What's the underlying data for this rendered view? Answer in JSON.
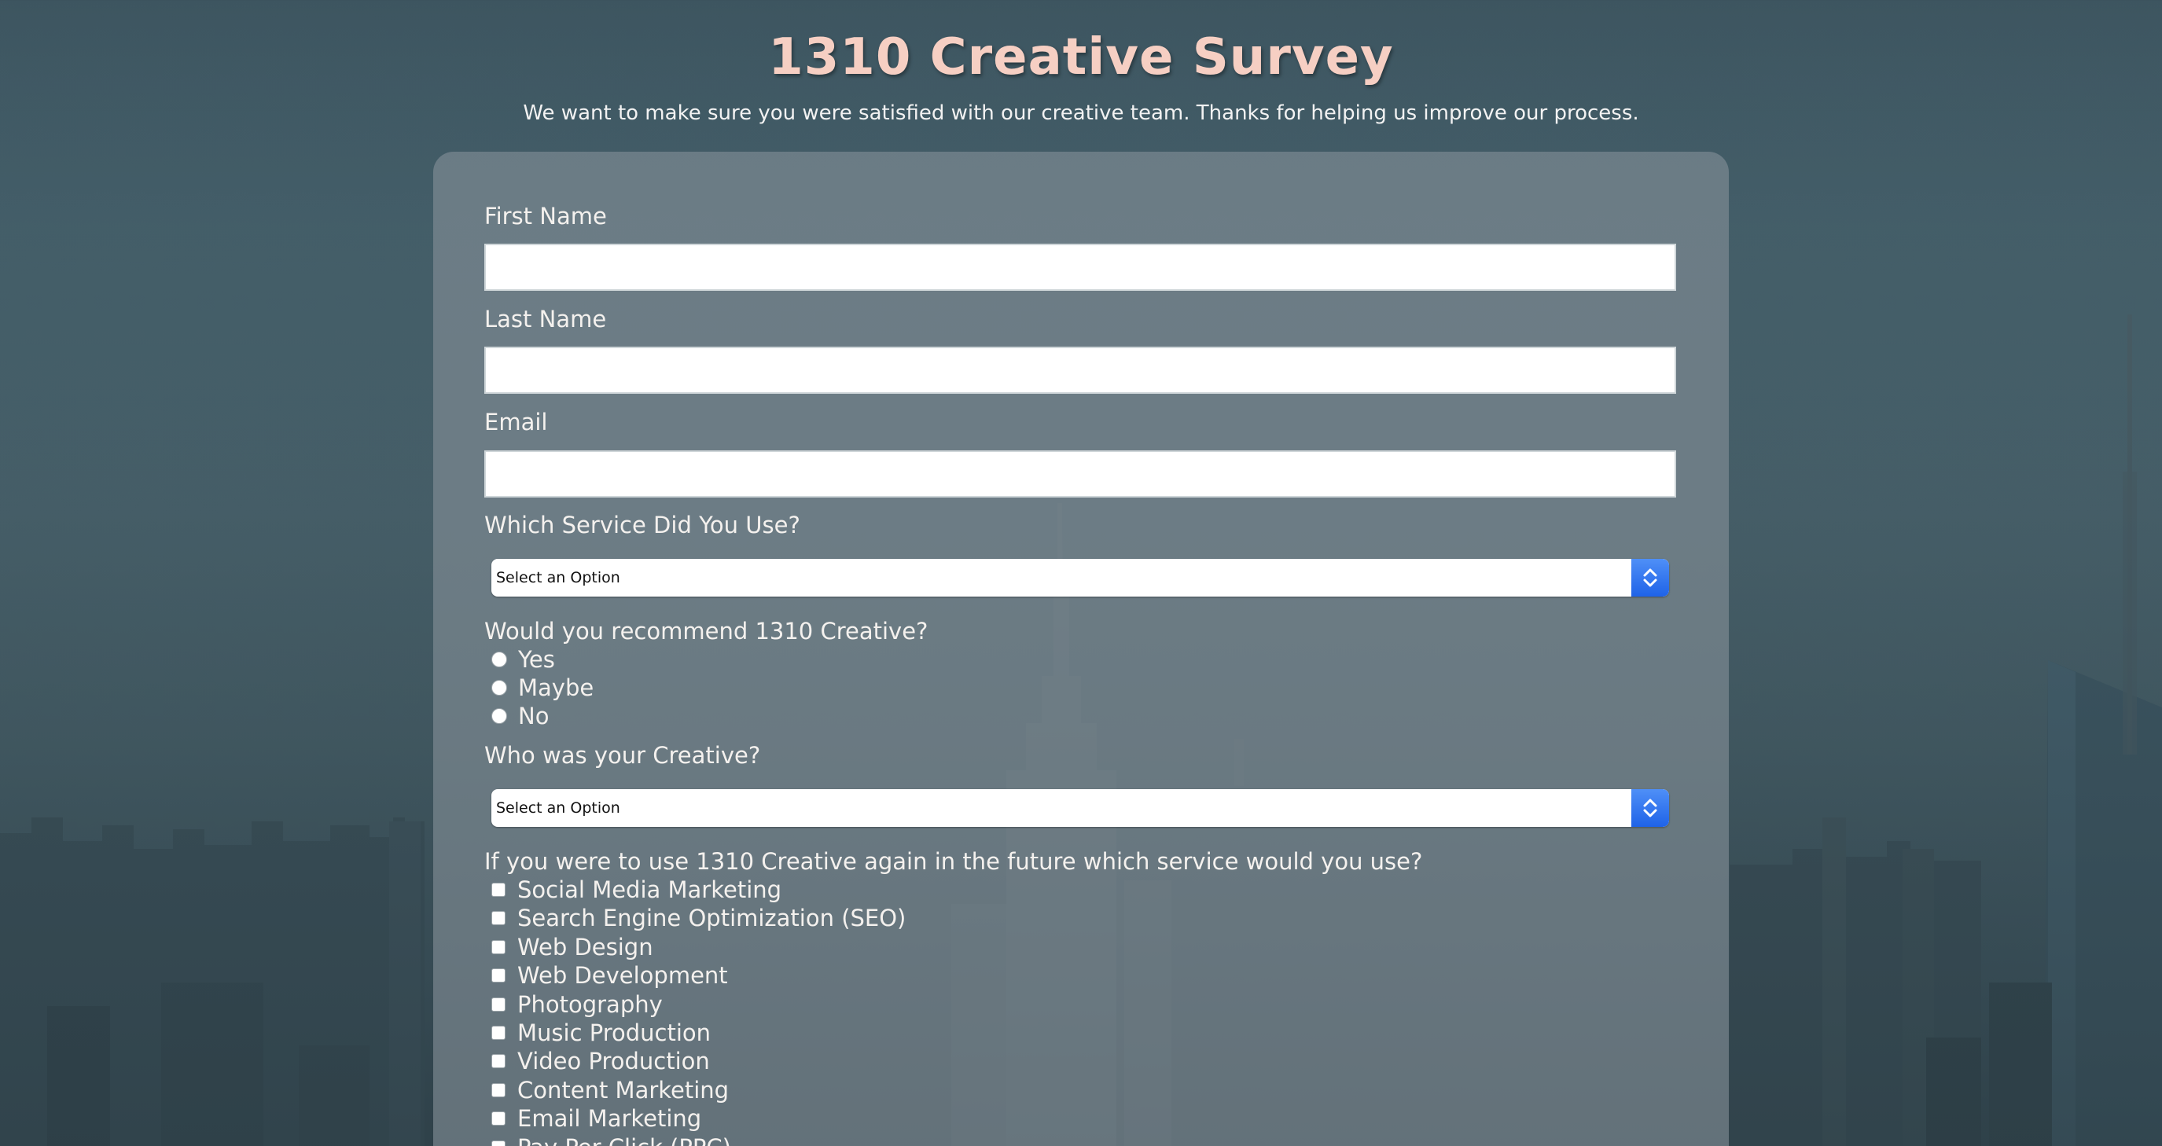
{
  "header": {
    "title": "1310 Creative Survey",
    "subtitle": "We want to make sure you were satisfied with our creative team. Thanks for helping us improve our process."
  },
  "form": {
    "first_name": {
      "label": "First Name",
      "value": "",
      "placeholder": ""
    },
    "last_name": {
      "label": "Last Name",
      "value": "",
      "placeholder": ""
    },
    "email": {
      "label": "Email",
      "value": "",
      "placeholder": ""
    },
    "service_used": {
      "label": "Which Service Did You Use?",
      "selected": "Select an Option"
    },
    "recommend": {
      "label": "Would you recommend 1310 Creative?",
      "options": [
        "Yes",
        "Maybe",
        "No"
      ]
    },
    "creative": {
      "label": "Who was your Creative?",
      "selected": "Select an Option"
    },
    "future_service": {
      "label": "If you were to use 1310 Creative again in the future which service would you use?",
      "options": [
        "Social Media Marketing",
        "Search Engine Optimization (SEO)",
        "Web Design",
        "Web Development",
        "Photography",
        "Music Production",
        "Video Production",
        "Content Marketing",
        "Email Marketing",
        "Pay Per Click (PPC)"
      ]
    }
  },
  "colors": {
    "title": "#f6cfc3",
    "label": "#f4f1ee",
    "select_accent": "#1f63e8",
    "card_background": "rgba(132,144,152,0.62)"
  },
  "icons": {
    "select_arrow": "chevron-up-down-icon"
  }
}
